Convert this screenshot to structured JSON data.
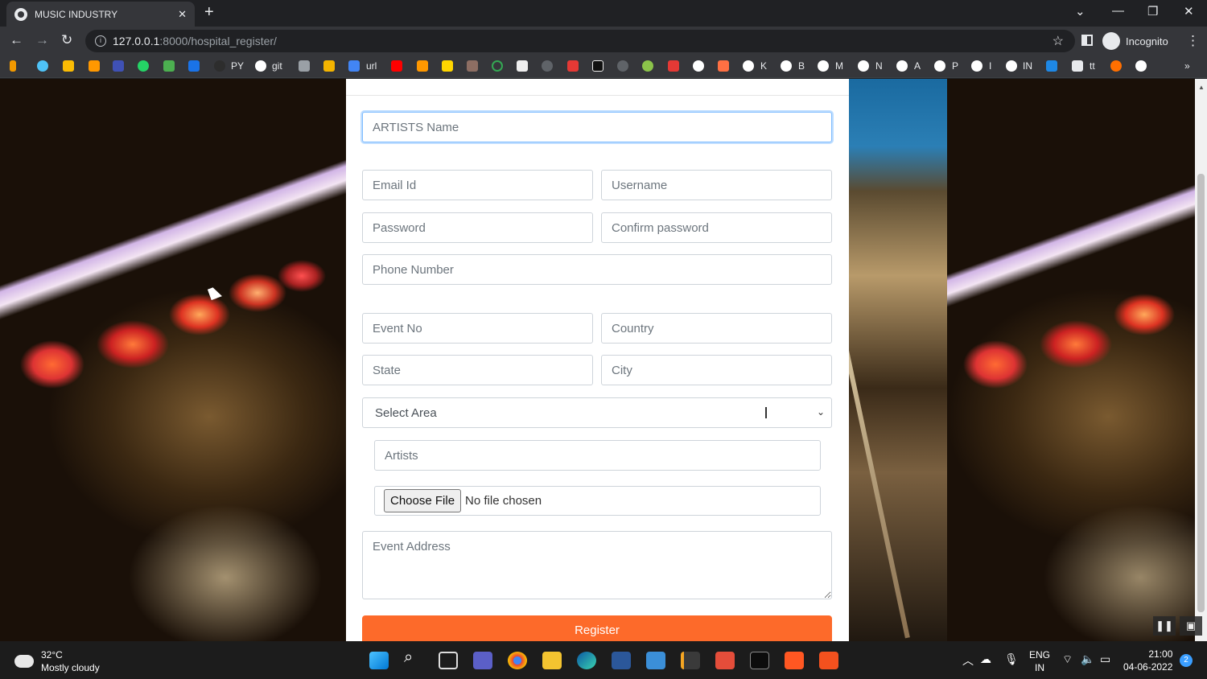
{
  "browser": {
    "tab_title": "MUSIC INDUSTRY",
    "url_host": "127.0.0.1",
    "url_path": ":8000/hospital_register/",
    "profile_label": "Incognito",
    "bookmarks": [
      "PY",
      "git",
      "url",
      "K",
      "B",
      "M",
      "N",
      "A",
      "P",
      "I",
      "IN",
      "tt"
    ]
  },
  "form": {
    "artists_name_placeholder": "ARTISTS Name",
    "email_placeholder": "Email Id",
    "username_placeholder": "Username",
    "password_placeholder": "Password",
    "confirm_password_placeholder": "Confirm password",
    "phone_placeholder": "Phone Number",
    "event_no_placeholder": "Event No",
    "country_placeholder": "Country",
    "state_placeholder": "State",
    "city_placeholder": "City",
    "select_area_value": "Select Area",
    "artists_placeholder": "Artists",
    "file_button_label": "Choose File",
    "file_status": "No file chosen",
    "event_address_placeholder": "Event Address",
    "register_label": "Register",
    "register_color": "#fd6a2a"
  },
  "taskbar": {
    "temperature": "32°C",
    "weather_desc": "Mostly cloudy",
    "lang_top": "ENG",
    "lang_bottom": "IN",
    "time": "21:00",
    "date": "04-06-2022",
    "notification_count": "2"
  }
}
